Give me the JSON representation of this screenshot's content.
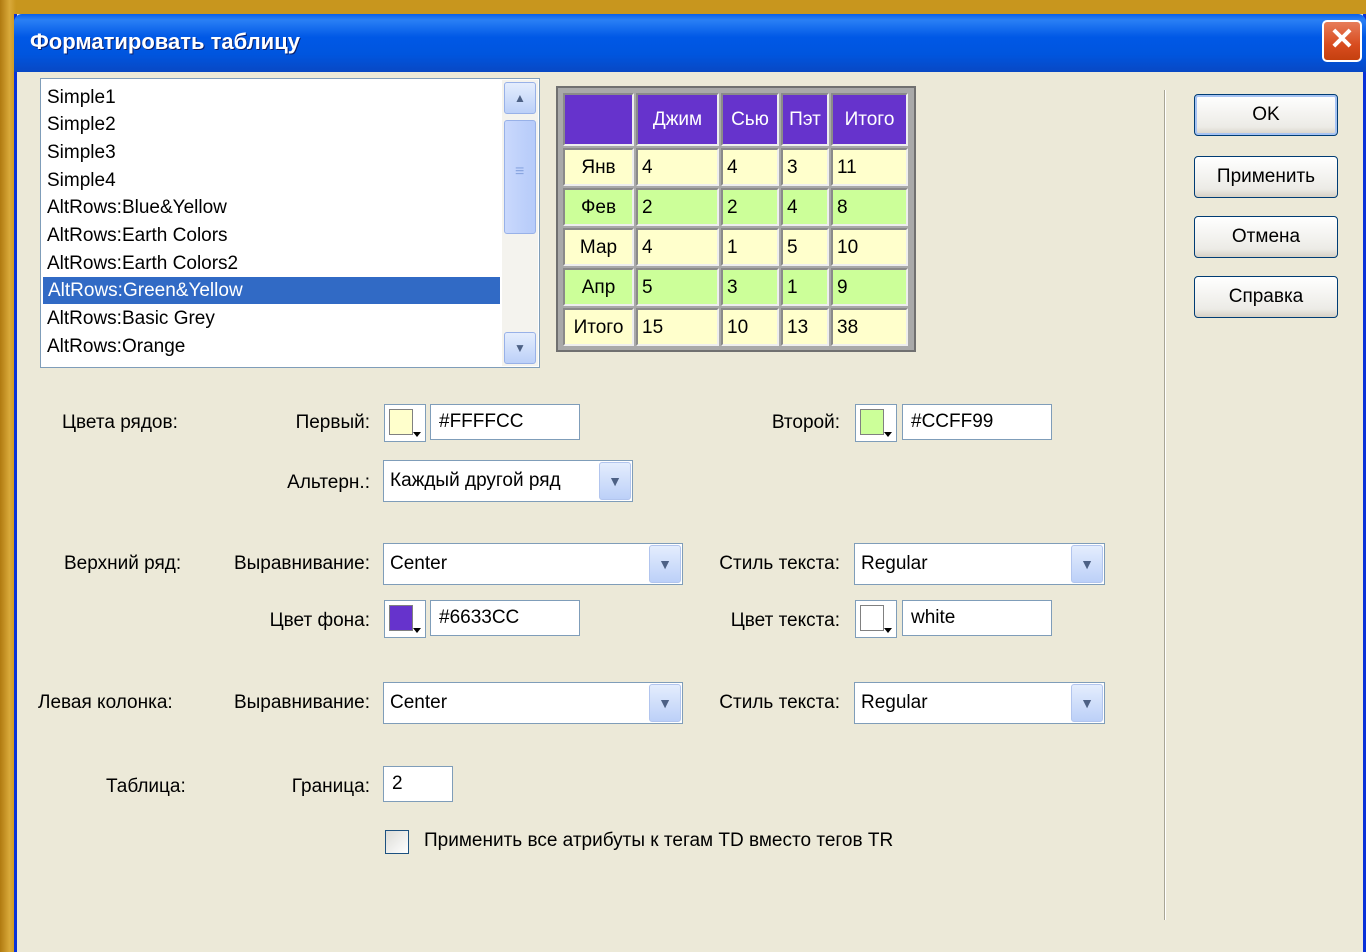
{
  "dialog": {
    "title": "Форматировать таблицу",
    "close_glyph": "✕"
  },
  "style_list": {
    "items": [
      "Simple1",
      "Simple2",
      "Simple3",
      "Simple4",
      "AltRows:Blue&Yellow",
      "AltRows:Earth Colors",
      "AltRows:Earth Colors2",
      "AltRows:Green&Yellow",
      "AltRows:Basic Grey",
      "AltRows:Orange"
    ],
    "selected": "AltRows:Green&Yellow",
    "scroll_up_glyph": "▲",
    "scroll_down_glyph": "▼",
    "thumb_grip_glyph": "≡"
  },
  "preview": {
    "header": [
      "",
      "Джим",
      "Сью",
      "Пэт",
      "Итого"
    ],
    "rows": [
      [
        "Янв",
        "4",
        "4",
        "3",
        "11"
      ],
      [
        "Фев",
        "2",
        "2",
        "4",
        "8"
      ],
      [
        "Мар",
        "4",
        "1",
        "5",
        "10"
      ],
      [
        "Апр",
        "5",
        "3",
        "1",
        "9"
      ],
      [
        "Итого",
        "15",
        "10",
        "13",
        "38"
      ]
    ]
  },
  "buttons": {
    "ok": "OK",
    "apply": "Применить",
    "cancel": "Отмена",
    "help": "Справка"
  },
  "row_colors": {
    "label": "Цвета рядов:",
    "first_label": "Первый:",
    "first_value": "#FFFFCC",
    "second_label": "Второй:",
    "second_value": "#CCFF99",
    "alternate_label": "Альтерн.:",
    "alternate_value": "Каждый другой ряд"
  },
  "top_row": {
    "label": "Верхний ряд:",
    "align_label": "Выравнивание:",
    "align_value": "Center",
    "text_style_label": "Стиль текста:",
    "text_style_value": "Regular",
    "bg_color_label": "Цвет фона:",
    "bg_color_value": "#6633CC",
    "text_color_label": "Цвет текста:",
    "text_color_value": "white"
  },
  "left_column": {
    "label": "Левая колонка:",
    "align_label": "Выравнивание:",
    "align_value": "Center",
    "text_style_label": "Стиль текста:",
    "text_style_value": "Regular"
  },
  "table": {
    "label": "Таблица:",
    "border_label": "Граница:",
    "border_value": "2",
    "td_checkbox_label": "Применить все атрибуты к тегам TD вместо тегов TR",
    "td_checkbox_checked": false
  },
  "colors": {
    "header_bg": "#6633CC",
    "row_odd": "#FFFFCC",
    "row_even": "#CCFF99",
    "selection": "#316AC5",
    "title_blue": "#0055DE"
  },
  "icons": {
    "dropdown_arrow": "chevron-down-icon",
    "close": "close-icon"
  }
}
